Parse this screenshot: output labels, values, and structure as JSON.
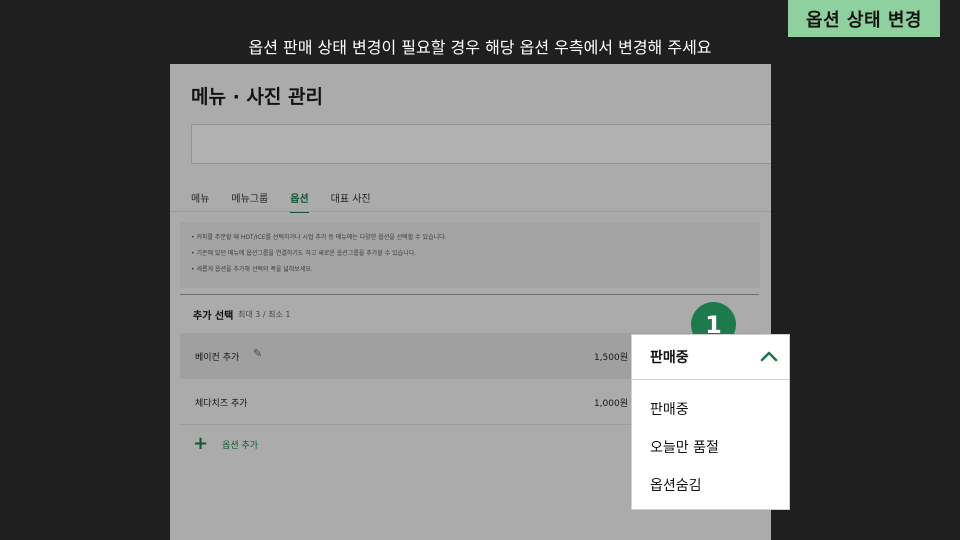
{
  "badge": "옵션 상태 변경",
  "instruction": "옵션 판매 상태 변경이 필요할 경우 해당 옵션 우측에서 변경해 주세요",
  "page": {
    "title": "메뉴 · 사진 관리",
    "tabs": [
      "메뉴",
      "메뉴그룹",
      "옵션",
      "대표 사진"
    ],
    "notes": [
      "커피를 주문할 때 HOT/ICE를 선택하거나 시럽 추가 등 메뉴에는 다양한 옵션을 선택할 수 있습니다.",
      "기존에 있던 메뉴에 옵션그룹을 연결하기도 하고 새로운 옵션그룹을 추가할 수 있습니다.",
      "세롭게 옵션을 추가해 선택의 폭을 넓혀보세요."
    ],
    "section_title": "추가 선택",
    "section_sub": "최대 3 / 최소 1",
    "options": [
      {
        "name": "베이컨 추가",
        "price": "1,500원"
      },
      {
        "name": "체다치즈 추가",
        "price": "1,000원"
      }
    ],
    "add_option": "옵션 추가"
  },
  "step_number": "1",
  "dropdown": {
    "selected": "판매중",
    "items": [
      "판매중",
      "오늘만 품절",
      "옵션숨김"
    ]
  },
  "colors": {
    "accent": "#1e7a4c",
    "badge_bg": "#8fd19e",
    "background": "#1f1f1f"
  }
}
